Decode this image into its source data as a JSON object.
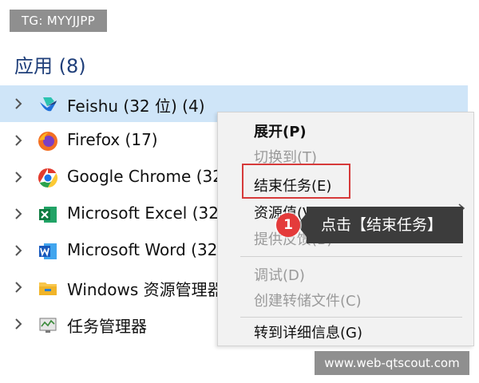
{
  "watermark_top": "TG: MYYJJPP",
  "watermark_bottom": "www.web-qtscout.com",
  "section": {
    "title": "应用 (8)"
  },
  "apps": [
    {
      "label": "Feishu (32 位) (4)",
      "icon": "feishu-icon",
      "selected": true
    },
    {
      "label": "Firefox (17)",
      "icon": "firefox-icon"
    },
    {
      "label": "Google Chrome (32",
      "icon": "chrome-icon"
    },
    {
      "label": "Microsoft Excel (32",
      "icon": "excel-icon"
    },
    {
      "label": "Microsoft Word (32",
      "icon": "word-icon"
    },
    {
      "label": "Windows 资源管理器",
      "icon": "folder-icon"
    },
    {
      "label": "任务管理器",
      "icon": "task-manager-icon"
    }
  ],
  "context_menu": {
    "items": {
      "expand": "展开(P)",
      "switch_to": "切换到(T)",
      "end_task": "结束任务(E)",
      "resource_values": "资源值(V)",
      "feedback": "提供反馈(B)",
      "debug": "调试(D)",
      "create_dump": "创建转储文件(C)",
      "go_to_details": "转到详细信息(G)"
    }
  },
  "callout": {
    "step": "1",
    "text": "点击【结束任务】"
  },
  "colors": {
    "selected_row": "#cfe5f8",
    "callout_bg": "#3c3c3c",
    "badge_red": "#e43b3b",
    "highlight_border": "#d63a3a"
  }
}
